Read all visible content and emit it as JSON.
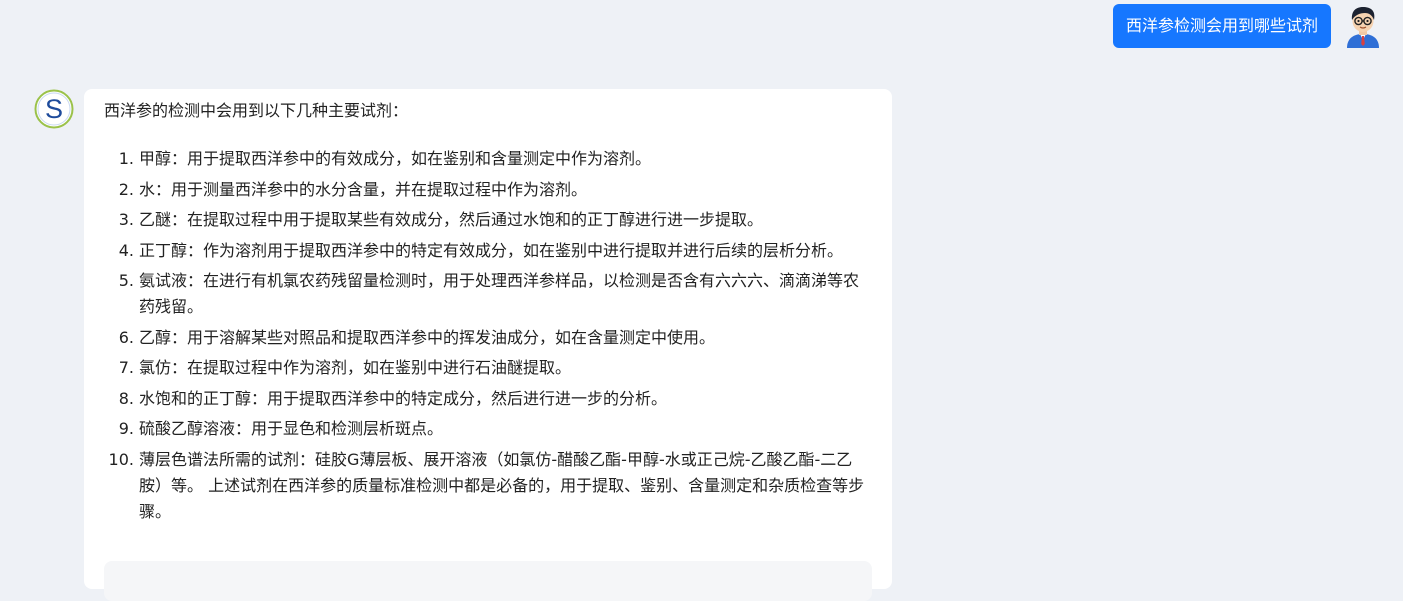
{
  "user": {
    "message": "西洋参检测会用到哪些试剂",
    "avatar_icon": "person-with-glasses-avatar-icon"
  },
  "bot": {
    "avatar_letter": "S",
    "avatar_icon": "s-logo-avatar-icon",
    "intro": "西洋参的检测中会用到以下几种主要试剂：",
    "items": [
      {
        "num": "1.",
        "text": "甲醇：用于提取西洋参中的有效成分，如在鉴别和含量测定中作为溶剂。"
      },
      {
        "num": "2.",
        "text": "水：用于测量西洋参中的水分含量，并在提取过程中作为溶剂。"
      },
      {
        "num": "3.",
        "text": "乙醚：在提取过程中用于提取某些有效成分，然后通过水饱和的正丁醇进行进一步提取。"
      },
      {
        "num": "4.",
        "text": "正丁醇：作为溶剂用于提取西洋参中的特定有效成分，如在鉴别中进行提取并进行后续的层析分析。"
      },
      {
        "num": "5.",
        "text": "氨试液：在进行有机氯农药残留量检测时，用于处理西洋参样品，以检测是否含有六六六、滴滴涕等农药残留。"
      },
      {
        "num": "6.",
        "text": "乙醇：用于溶解某些对照品和提取西洋参中的挥发油成分，如在含量测定中使用。"
      },
      {
        "num": "7.",
        "text": "氯仿：在提取过程中作为溶剂，如在鉴别中进行石油醚提取。"
      },
      {
        "num": "8.",
        "text": "水饱和的正丁醇：用于提取西洋参中的特定成分，然后进行进一步的分析。"
      },
      {
        "num": "9.",
        "text": "硫酸乙醇溶液：用于显色和检测层析斑点。"
      },
      {
        "num": "10.",
        "text": "薄层色谱法所需的试剂：硅胶G薄层板、展开溶液（如氯仿-醋酸乙酯-甲醇-水或正己烷-乙酸乙酯-二乙胺）等。 上述试剂在西洋参的质量标准检测中都是必备的，用于提取、鉴别、含量测定和杂质检查等步骤。"
      }
    ]
  },
  "colors": {
    "page_background": "#eef1f6",
    "user_bubble": "#1677ff",
    "bot_card": "#ffffff",
    "avatar_s": "#1e4b9b"
  }
}
